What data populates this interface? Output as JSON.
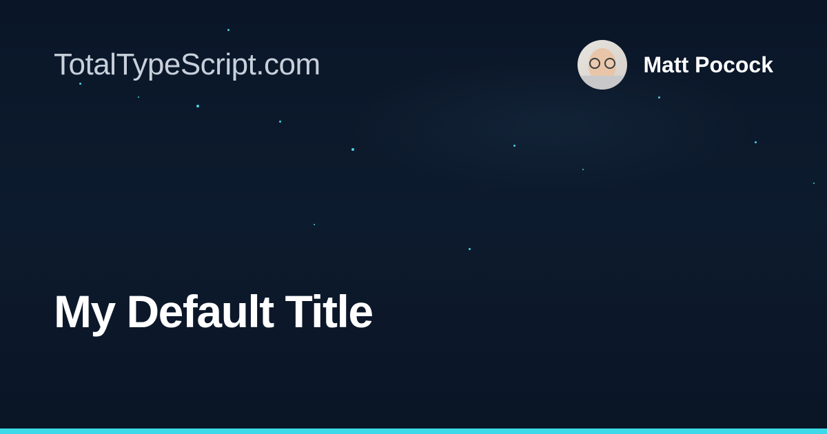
{
  "header": {
    "site_name": "TotalTypeScript.com",
    "author_name": "Matt Pocock"
  },
  "main": {
    "title": "My Default Title"
  }
}
